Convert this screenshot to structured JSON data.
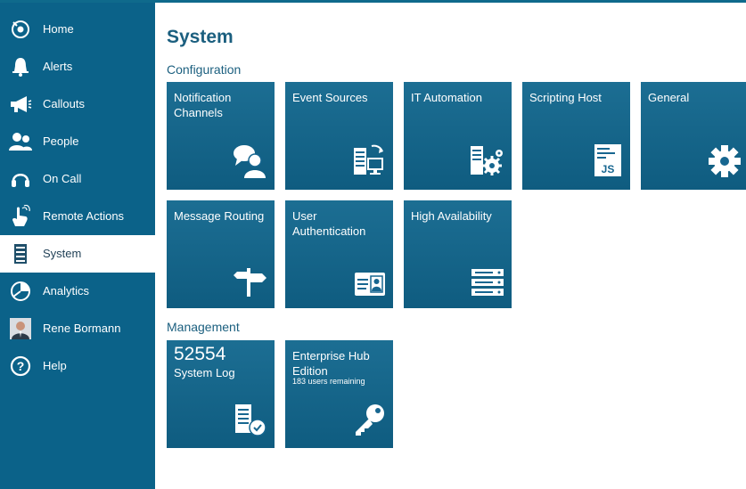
{
  "sidebar": {
    "items": [
      {
        "label": "Home",
        "icon": "home-icon"
      },
      {
        "label": "Alerts",
        "icon": "bell-icon"
      },
      {
        "label": "Callouts",
        "icon": "megaphone-icon"
      },
      {
        "label": "People",
        "icon": "people-icon"
      },
      {
        "label": "On Call",
        "icon": "headset-icon"
      },
      {
        "label": "Remote Actions",
        "icon": "touch-icon"
      },
      {
        "label": "System",
        "icon": "server-icon",
        "active": true
      },
      {
        "label": "Analytics",
        "icon": "pie-chart-icon"
      },
      {
        "label": "Rene Bormann",
        "icon": "user-avatar"
      },
      {
        "label": "Help",
        "icon": "help-icon"
      }
    ]
  },
  "page": {
    "title": "System",
    "sections": {
      "configuration": "Configuration",
      "management": "Management"
    }
  },
  "configuration_tiles": [
    {
      "label": "Notification Channels",
      "icon": "chat-person-icon"
    },
    {
      "label": "Event Sources",
      "icon": "event-sources-icon"
    },
    {
      "label": "IT Automation",
      "icon": "automation-gear-icon"
    },
    {
      "label": "Scripting Host",
      "icon": "js-script-icon"
    },
    {
      "label": "General",
      "icon": "gear-icon"
    },
    {
      "label": "Message Routing",
      "icon": "signpost-icon"
    },
    {
      "label": "User Authentication",
      "icon": "id-card-icon"
    },
    {
      "label": "High Availability",
      "icon": "server-rack-icon"
    }
  ],
  "management_tiles": {
    "system_log": {
      "count": "52554",
      "label": "System Log",
      "icon": "log-check-icon"
    },
    "edition": {
      "label": "Enterprise Hub Edition",
      "note": "183 users remaining",
      "icon": "key-icon"
    }
  },
  "colors": {
    "sidebar": "#0b6289",
    "tile": "#176690",
    "heading": "#1b5f7f"
  }
}
